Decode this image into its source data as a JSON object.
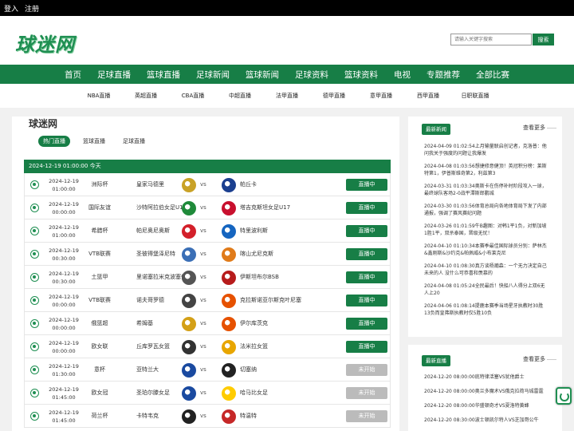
{
  "topbar": {
    "login": "登入",
    "register": "注册"
  },
  "logo": "球迷网",
  "search": {
    "placeholder": "请输入关键字搜索",
    "button": "搜索"
  },
  "nav": [
    "首页",
    "足球直播",
    "篮球直播",
    "足球新闻",
    "篮球新闻",
    "足球资料",
    "篮球资料",
    "电视",
    "专题推荐",
    "全部比赛"
  ],
  "subnav": [
    "NBA直播",
    "英超直播",
    "CBA直播",
    "中超直播",
    "法甲直播",
    "德甲直播",
    "意甲直播",
    "西甲直播",
    "日职联直播"
  ],
  "main": {
    "title": "球迷网",
    "tabs": [
      "热门直播",
      "篮球直播",
      "足球直播"
    ],
    "date_header": "2024-12-19 01:00:00  今天",
    "vs": "vs",
    "matches": [
      {
        "date": "2024-12-19",
        "time": "01:00:00",
        "league": "洲际杯",
        "home": "皇家马德里",
        "away": "帕丘卡",
        "status": "直播中",
        "live": true
      },
      {
        "date": "2024-12-19",
        "time": "00:00:00",
        "league": "国际友谊",
        "home": "沙特阿拉伯女足U17",
        "away": "塔吉克斯坦女足U17",
        "status": "直播中",
        "live": true
      },
      {
        "date": "2024-12-19",
        "time": "01:00:00",
        "league": "希腊杯",
        "home": "帕尼奥尼奥斯",
        "away": "特里波利斯",
        "status": "直播中",
        "live": true
      },
      {
        "date": "2024-12-19",
        "time": "00:30:00",
        "league": "VTB联赛",
        "home": "圣彼得堡泽尼特",
        "away": "喀山尤尼克斯",
        "status": "直播中",
        "live": true
      },
      {
        "date": "2024-12-19",
        "time": "00:30:00",
        "league": "土篮甲",
        "home": "里诺塞拉米克波塞伦",
        "away": "伊斯坦布尔BSB",
        "status": "直播中",
        "live": true
      },
      {
        "date": "2024-12-19",
        "time": "00:00:00",
        "league": "VTB联赛",
        "home": "诺夫哥罗德",
        "away": "克拉斯诺亚尔斯克叶尼塞",
        "status": "直播中",
        "live": true
      },
      {
        "date": "2024-12-19",
        "time": "00:00:00",
        "league": "俄篮超",
        "home": "希姆基",
        "away": "伊尔库茨克",
        "status": "直播中",
        "live": true
      },
      {
        "date": "2024-12-19",
        "time": "00:00:00",
        "league": "欧女联",
        "home": "丘库罗瓦女篮",
        "away": "法米拉女篮",
        "status": "直播中",
        "live": true
      },
      {
        "date": "2024-12-19",
        "time": "01:30:00",
        "league": "意杯",
        "home": "亚特兰大",
        "away": "切塞纳",
        "status": "未开始",
        "live": false
      },
      {
        "date": "2024-12-19",
        "time": "01:45:00",
        "league": "欧女冠",
        "home": "圣珀尔滕女足",
        "away": "哈马比女足",
        "status": "未开始",
        "live": false
      },
      {
        "date": "2024-12-19",
        "time": "01:45:00",
        "league": "荷兰杯",
        "home": "卡特韦克",
        "away": "特温特",
        "status": "未开始",
        "live": false
      }
    ]
  },
  "sidebar_news": {
    "tag": "最新新闻",
    "more": "查看更多",
    "items": [
      "2024-04-09 01:02:54上月输量联启创记者，克洛普：他问我关于强度的问题让我爆发",
      "2024-04-08 01:03:56想捷修意健顶！英冠积分榜：莱斯特第1，伊普斯维奇第2，利兹第3",
      "2024-03-31 01:03:34奥斯卡在伤停补时阶段攻入一球，最终球队客场2-0战平潭斯郎鹏城",
      "2024-03-30 01:03:56体育总局向各地体育局下发了内部通报，强调了赛风赛纪问题",
      "2024-03-26 01:01:59牛B趣图：对韩1平1负，对新加坡1胜1平，双杀泰国，晋级无忧！",
      "2024-04-10 01:10:34本赛季最佳国际球员分别：萨林杰&鑫刚斯&沙约克&帕佩威&小布莱克尼",
      "2024-04-10 01:08:30真方谈杨瀚森：一个无力决定自己未来的人 没什么可恭喜和羡慕的",
      "2024-04-08 01:05:24全民最后！快船八人得分上双6无人上20",
      "2024-04-06 01:08:14提鹿本赛季当场星牙执教时30胜13负而皇弗斯执教时仅5胜10负"
    ]
  },
  "sidebar_matches": {
    "tag": "最新直播",
    "more": "查看更多",
    "items": [
      "2024-12-20 08:00:00底特律活塞VS犹他爵士",
      "2024-12-20 08:00:00奥兰多魔术VS俄克拉荷马城雷霆",
      "2024-12-20 08:00:00华盛顿奇才VS夏洛特黄蜂",
      "2024-12-20 08:30:00波士顿凯尔特人VS芝加哥公牛"
    ]
  },
  "colors": {
    "brand": "#177e46",
    "topbar": "#000000",
    "disabled": "#bbbbbb"
  }
}
